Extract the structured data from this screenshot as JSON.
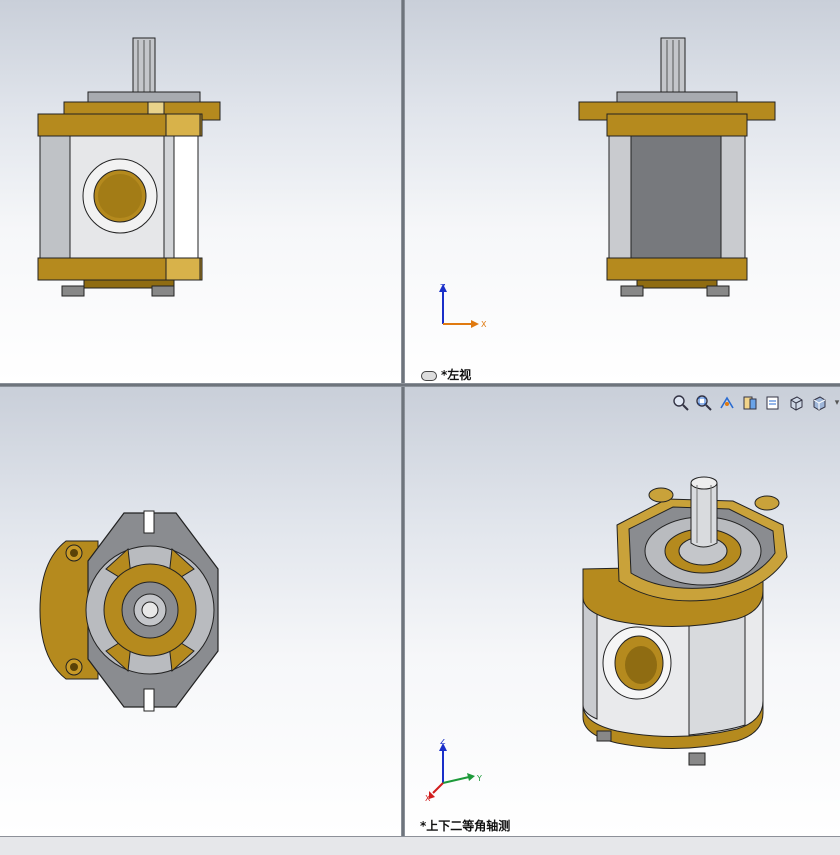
{
  "viewports": {
    "top_left": {
      "label": ""
    },
    "top_right": {
      "label": "*左视"
    },
    "bottom_left": {
      "label": ""
    },
    "bottom_right": {
      "label": "*上下二等角轴测"
    }
  },
  "triad": {
    "top_right": {
      "z": "Z",
      "x": "X"
    },
    "bottom_right": {
      "z": "Z",
      "y": "Y",
      "x": "X"
    }
  },
  "toolbar": {
    "icons": [
      "zoom-to-fit-icon",
      "zoom-to-area-icon",
      "previous-view-icon",
      "section-view-icon",
      "dynamic-annotation-view-icon",
      "view-orientation-icon",
      "display-style-icon",
      "hide-show-items-icon"
    ]
  },
  "colors": {
    "brass": "#b58a1e",
    "steel": "#c9cbcf",
    "viewport_top": "#c9cfd9",
    "viewport_bottom": "#ffffff",
    "splitter": "#5f656d"
  }
}
